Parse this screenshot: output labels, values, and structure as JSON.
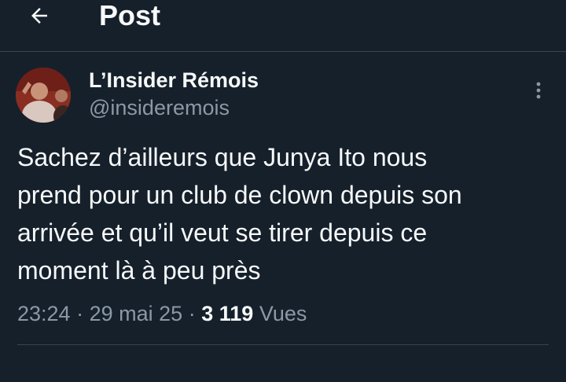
{
  "header": {
    "title": "Post",
    "back_icon": "arrow-left-icon"
  },
  "author": {
    "name": "L’Insider Rémois",
    "handle": "@insideremois",
    "avatar_icon": "avatar-photo"
  },
  "post": {
    "text": "Sachez d’ailleurs que Junya Ito nous\nprend pour un club de clown depuis son\narrivée et qu’il veut se tirer depuis ce\nmoment là à peu près",
    "time": "23:24",
    "separator": "·",
    "date": "29 mai 25",
    "views_count": "3 119",
    "views_label": "Vues"
  },
  "more_icon": "more-vertical-icon",
  "colors": {
    "background": "#15202b",
    "text": "#f7f9f9",
    "secondary": "#8b98a5",
    "border": "#38444d"
  }
}
